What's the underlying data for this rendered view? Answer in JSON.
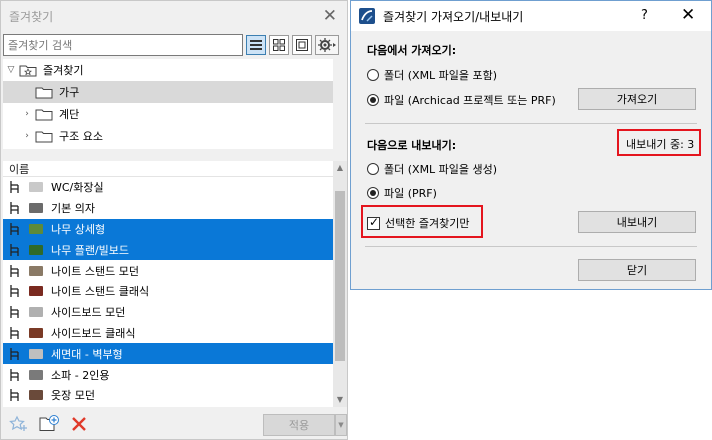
{
  "favorites": {
    "title": "즐겨찾기",
    "search_placeholder": "즐겨찾기 검색",
    "tree": {
      "root": "즐겨찾기",
      "items": [
        "가구",
        "계단",
        "구조 요소"
      ]
    },
    "list": {
      "header": "이름",
      "rows": [
        {
          "name": "WC/화장실",
          "selected": false
        },
        {
          "name": "기본 의자",
          "selected": false
        },
        {
          "name": "나무 상세형",
          "selected": true
        },
        {
          "name": "나무 플랜/빌보드",
          "selected": true
        },
        {
          "name": "나이트 스탠드 모던",
          "selected": false
        },
        {
          "name": "나이트 스탠드 클래식",
          "selected": false
        },
        {
          "name": "사이드보드 모던",
          "selected": false
        },
        {
          "name": "사이드보드 클래식",
          "selected": false
        },
        {
          "name": "세면대 - 벽부형",
          "selected": true
        },
        {
          "name": "소파 - 2인용",
          "selected": false
        },
        {
          "name": "옷장 모던",
          "selected": false
        }
      ]
    },
    "apply_label": "적용"
  },
  "dialog": {
    "title": "즐겨찾기 가져오기/내보내기",
    "help": "?",
    "import": {
      "title": "다음에서 가져오기:",
      "opt_folder": "폴더 (XML 파일을 포함)",
      "opt_file": "파일 (Archicad 프로젝트 또는 PRF)",
      "button": "가져오기"
    },
    "export": {
      "title": "다음으로 내보내기:",
      "count_label": "내보내기 중: 3",
      "opt_folder": "폴더 (XML 파일을 생성)",
      "opt_file": "파일 (PRF)",
      "selected_only": "선택한 즐겨찾기만",
      "button": "내보내기"
    },
    "close_button": "닫기"
  },
  "colors": {
    "selection": "#0a78d7",
    "highlight_box": "#e4151e"
  }
}
